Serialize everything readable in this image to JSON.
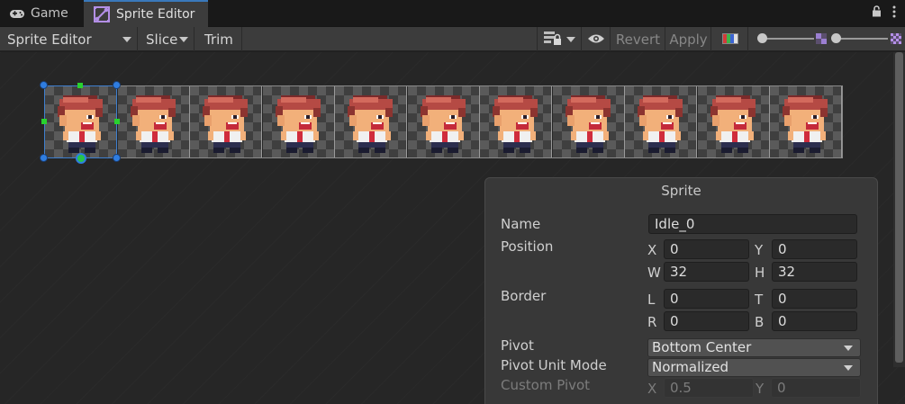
{
  "tabs": {
    "game": "Game",
    "sprite_editor": "Sprite Editor"
  },
  "toolbar": {
    "mode": "Sprite Editor",
    "slice": "Slice",
    "trim": "Trim",
    "revert": "Revert",
    "apply": "Apply"
  },
  "sprite_panel": {
    "title": "Sprite",
    "name_label": "Name",
    "name_value": "Idle_0",
    "position_label": "Position",
    "x_label": "X",
    "x_value": "0",
    "y_label": "Y",
    "y_value": "0",
    "w_label": "W",
    "w_value": "32",
    "h_label": "H",
    "h_value": "32",
    "border_label": "Border",
    "l_label": "L",
    "l_value": "0",
    "t_label": "T",
    "t_value": "0",
    "r_label": "R",
    "r_value": "0",
    "b_label": "B",
    "b_value": "0",
    "pivot_label": "Pivot",
    "pivot_value": "Bottom Center",
    "pivot_unit_label": "Pivot Unit Mode",
    "pivot_unit_value": "Normalized",
    "custom_pivot_label": "Custom Pivot",
    "custom_x_label": "X",
    "custom_x_value": "0.5",
    "custom_y_label": "Y",
    "custom_y_value": "0"
  },
  "sprite_sheet": {
    "frame_count": 11,
    "selected_frame": 1
  },
  "icons": [
    "gamepad-icon",
    "sprite-editor-icon",
    "lock-icon",
    "more-menu-icon",
    "layer-lock-icon",
    "eye-icon",
    "color-channel-icon",
    "mip-icon"
  ],
  "colors": {
    "accent": "#3a79bb",
    "handle_blue": "#2f7de0",
    "handle_green": "#29d12e"
  }
}
